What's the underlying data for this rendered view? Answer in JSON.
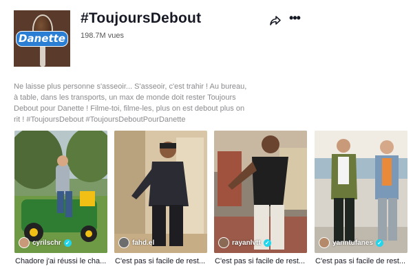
{
  "hashtag": {
    "title": "#ToujoursDebout",
    "views": "198.7M vues",
    "logo_text": "Danette"
  },
  "description": "Ne laisse plus personne s'asseoir... S'asseoir, c'est trahir ! Au bureau, à table, dans les transports, un max de monde doit rester Toujours Debout pour Danette ! Filme-toi, filme-les, plus on est debout plus on rit ! #ToujoursDebout #ToujoursDeboutPourDanette",
  "actions": {
    "share": "share-icon",
    "more": "more-icon",
    "more_glyph": "•••"
  },
  "colors": {
    "verified": "#20d5ec",
    "logo_bg": "#5a3a2a",
    "logo_badge": "#2a7fd4"
  },
  "videos": [
    {
      "username": "cyrilschr",
      "verified": true,
      "caption": "Chadore j'ai réussi le cha..."
    },
    {
      "username": "fahd.el",
      "verified": false,
      "caption": "C'est pas si facile de rest..."
    },
    {
      "username": "rayanlvtt",
      "verified": true,
      "caption": "C'est pas si facile de rest..."
    },
    {
      "username": "yanntufanes",
      "verified": true,
      "caption": "C'est pas si facile de rest..."
    }
  ]
}
